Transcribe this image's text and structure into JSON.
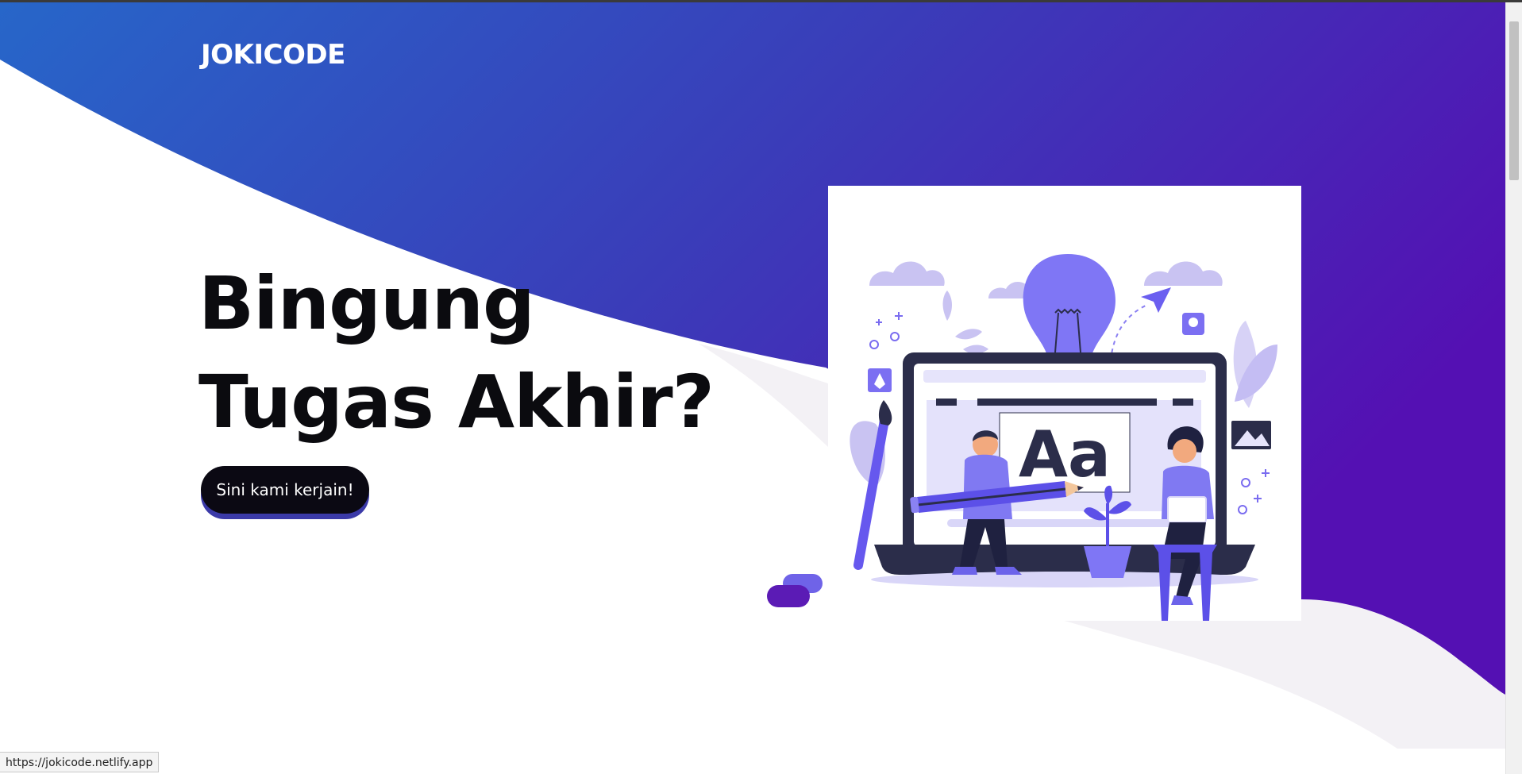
{
  "header": {
    "brand": "JOKICODE"
  },
  "hero": {
    "headline_line1": "Bingung",
    "headline_line2": "Tugas Akhir?",
    "cta_label": "Sini kami kerjain!"
  },
  "illustration": {
    "sign_text": "Aa"
  },
  "status_bar": {
    "url": "https://jokicode.netlify.app"
  },
  "colors": {
    "gradient_start": "#2766c9",
    "gradient_mid": "#3c37b8",
    "gradient_end": "#5410b3",
    "cta_background": "#0b0913",
    "cta_shadow": "#3b3aa8",
    "headline": "#0b0b0f"
  }
}
